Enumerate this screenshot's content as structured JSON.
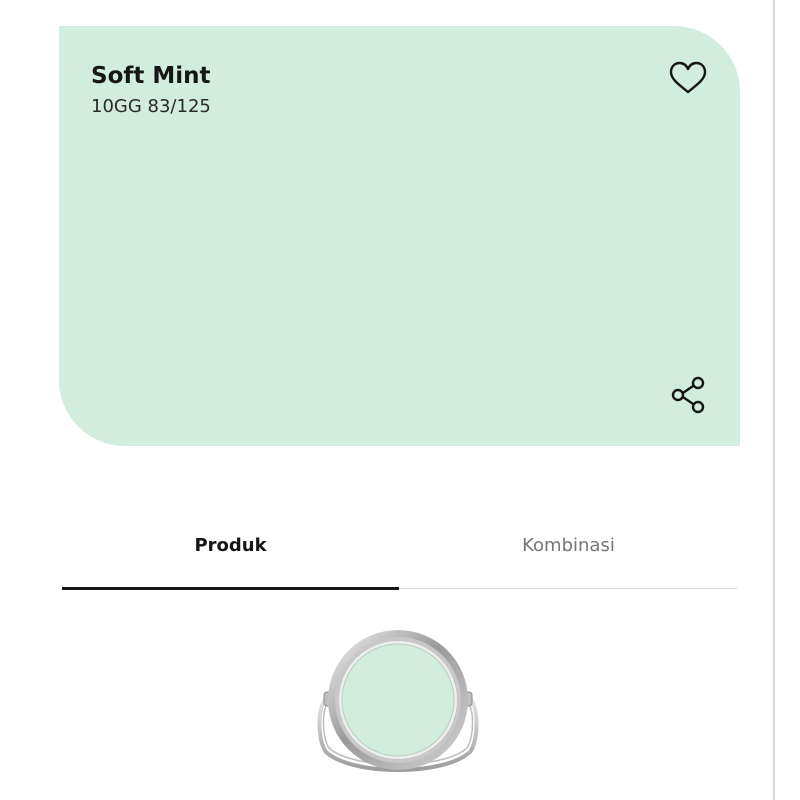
{
  "colors": {
    "swatch": "#D2ECDD",
    "text_primary": "#161616",
    "tab_inactive": "#777777",
    "tab_indicator": "#161616",
    "tab_baseline": "#D9D9D9"
  },
  "color_card": {
    "name": "Soft Mint",
    "code": "10GG 83/125",
    "favorite_icon": "heart-outline-icon",
    "share_icon": "share-icon"
  },
  "tabs": {
    "items": [
      {
        "label": "Produk",
        "active": true
      },
      {
        "label": "Kombinasi",
        "active": false
      }
    ]
  },
  "product": {
    "image": "paint-can-top-view",
    "lid_color": "#D2ECDD"
  }
}
